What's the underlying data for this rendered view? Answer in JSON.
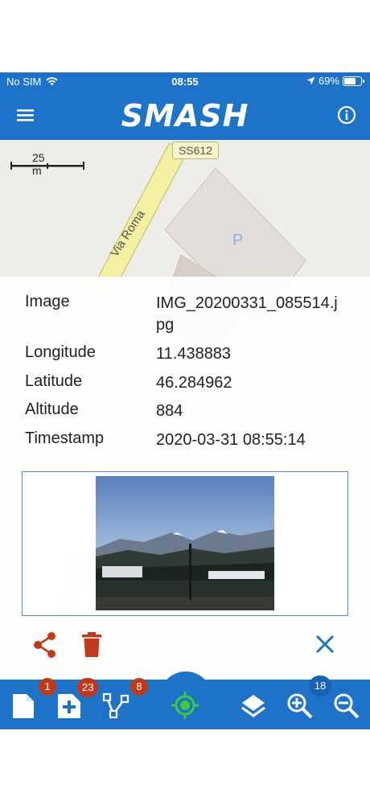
{
  "status_bar": {
    "carrier": "No SIM",
    "time": "08:55",
    "battery": "69%",
    "icons": [
      "wifi-icon",
      "location-arrow-icon",
      "battery-icon"
    ]
  },
  "app_bar": {
    "title": "SMASH",
    "left_icon": "menu-icon",
    "right_icon": "info-icon"
  },
  "map": {
    "scale_label": "25 m",
    "road_ref": "SS612",
    "road_name": "Via Roma",
    "parking_label": "P"
  },
  "image_info": {
    "rows": [
      {
        "key": "Image",
        "value": "IMG_20200331_085514.jpg"
      },
      {
        "key": "Longitude",
        "value": "11.438883"
      },
      {
        "key": "Latitude",
        "value": "46.284962"
      },
      {
        "key": "Altitude",
        "value": "884"
      },
      {
        "key": "Timestamp",
        "value": "2020-03-31 08:55:14"
      }
    ]
  },
  "actions": {
    "share_icon": "share-icon",
    "delete_icon": "delete-icon",
    "close_icon": "close-icon"
  },
  "bottom_nav": {
    "notes_badge": "1",
    "add_notes_badge": "23",
    "gps_logs_badge": "8",
    "zoom_level": "18"
  },
  "colors": {
    "primary": "#1e73c8",
    "accent_orange": "#c0391b",
    "gps_green": "#3ec93e"
  }
}
